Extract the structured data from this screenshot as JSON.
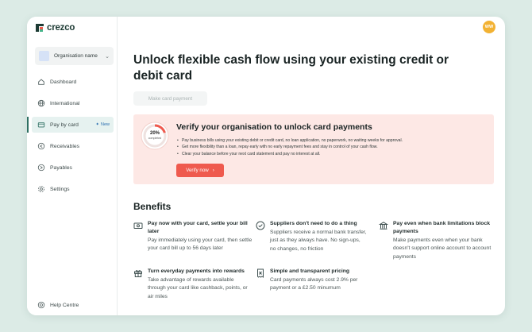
{
  "brand": {
    "name": "crezco"
  },
  "sidebar": {
    "org_name": "Organisation name",
    "items": [
      {
        "label": "Dashboard",
        "icon": "home-icon"
      },
      {
        "label": "International",
        "icon": "globe-icon"
      },
      {
        "label": "Pay by card",
        "icon": "card-icon",
        "badge": "New"
      },
      {
        "label": "Receivables",
        "icon": "receivables-icon"
      },
      {
        "label": "Payables",
        "icon": "payables-icon"
      },
      {
        "label": "Settings",
        "icon": "gear-icon"
      }
    ],
    "help": "Help Centre"
  },
  "header": {
    "avatar_initials": "WW"
  },
  "main": {
    "title": "Unlock flexible cash flow using your existing  credit or debit card",
    "card_button": "Make card payment",
    "verify": {
      "progress_pct": "20%",
      "progress_label": "completed",
      "progress_value": 0.2,
      "title": "Verify your organisation to unlock card payments",
      "bullets": [
        "Pay business bills using your existing debit or credit card, no loan application, no paperwork, no waiting weeks for approval.",
        "Get more flexibility than a loan, repay early with no early repayment fees and stay in control of your cash flow.",
        "Clear your balance before your next card statement and pay no interest at all."
      ],
      "button": "Verify now",
      "button_chevron": "›"
    },
    "benefits_title": "Benefits",
    "benefits": [
      {
        "icon": "cash-icon",
        "title": "Pay now with your card, settle your bill later",
        "desc": "Pay immediately using your card, then settle your card bill up to 56 days later"
      },
      {
        "icon": "check-circle-icon",
        "title": "Suppliers don't need to do a thing",
        "desc": "Suppliers receive a normal bank transfer, just as they always have. No sign-ups, no changes, no friction"
      },
      {
        "icon": "bank-icon",
        "title": "Pay even when bank limitations block payments",
        "desc": "Make payments even when your bank doesn't support online account to account payments"
      },
      {
        "icon": "gift-icon",
        "title": "Turn everyday payments into rewards",
        "desc": "Take advantage of rewards available through your card like cashback, points, or air miles"
      },
      {
        "icon": "receipt-icon",
        "title": "Simple and transparent pricing",
        "desc": "Card payments always cost 2.9% per payment or a £2.50 minumum"
      }
    ]
  },
  "colors": {
    "background": "#dcebe6",
    "accent": "#ef5a4e",
    "verify_bg": "#fde8e5",
    "active_nav": "#e6f2f0",
    "avatar": "#f2b233"
  }
}
